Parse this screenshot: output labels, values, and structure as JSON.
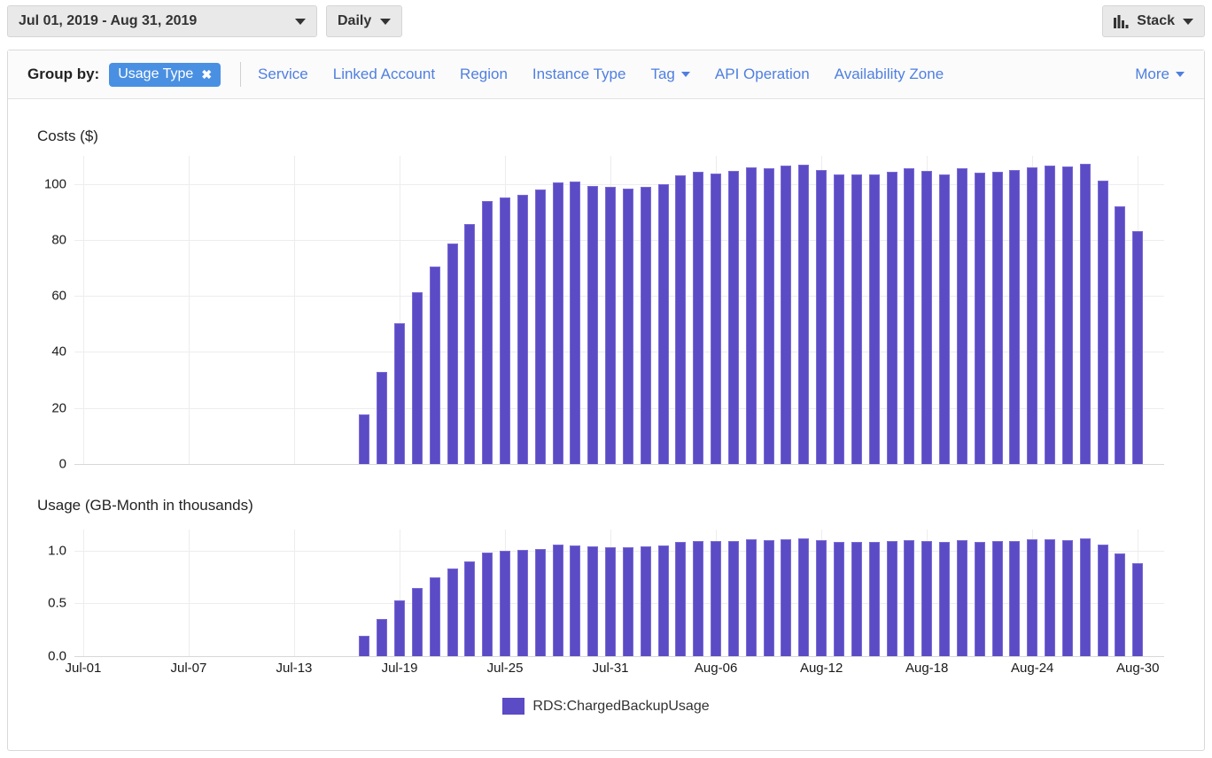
{
  "toolbar": {
    "date_range": "Jul 01, 2019 - Aug 31, 2019",
    "granularity": "Daily",
    "stack_label": "Stack",
    "stack_icon": "bar-chart-icon",
    "caret_icon": "chevron-down-icon"
  },
  "groupbar": {
    "label": "Group by:",
    "active_pill": "Usage Type",
    "pill_remove_icon": "close-icon",
    "options": [
      {
        "label": "Service",
        "has_caret": false
      },
      {
        "label": "Linked Account",
        "has_caret": false
      },
      {
        "label": "Region",
        "has_caret": false
      },
      {
        "label": "Instance Type",
        "has_caret": false
      },
      {
        "label": "Tag",
        "has_caret": true
      },
      {
        "label": "API Operation",
        "has_caret": false
      },
      {
        "label": "Availability Zone",
        "has_caret": false
      }
    ],
    "more": {
      "label": "More",
      "has_caret": true
    }
  },
  "legend": {
    "series_name": "RDS:ChargedBackupUsage",
    "color": "#5b4bc4"
  },
  "colors": {
    "bar": "#5b4bc4",
    "bar_edge": "#7a6bd6",
    "link": "#4f7fe0",
    "pill": "#4a90e2",
    "grid": "#ededed"
  },
  "chart_data": [
    {
      "type": "bar",
      "title": "Costs ($)",
      "ylabel": "Costs ($)",
      "xlabel": "",
      "ylim": [
        0,
        110
      ],
      "yticks": [
        0,
        20,
        40,
        60,
        80,
        100
      ],
      "ytick_labels": [
        "0",
        "20",
        "40",
        "60",
        "80",
        "100"
      ],
      "grid": true,
      "legend_position": "bottom",
      "x": [
        "Jul-01",
        "Jul-02",
        "Jul-03",
        "Jul-04",
        "Jul-05",
        "Jul-06",
        "Jul-07",
        "Jul-08",
        "Jul-09",
        "Jul-10",
        "Jul-11",
        "Jul-12",
        "Jul-13",
        "Jul-14",
        "Jul-15",
        "Jul-16",
        "Jul-17",
        "Jul-18",
        "Jul-19",
        "Jul-20",
        "Jul-21",
        "Jul-22",
        "Jul-23",
        "Jul-24",
        "Jul-25",
        "Jul-26",
        "Jul-27",
        "Jul-28",
        "Jul-29",
        "Jul-30",
        "Jul-31",
        "Aug-01",
        "Aug-02",
        "Aug-03",
        "Aug-04",
        "Aug-05",
        "Aug-06",
        "Aug-07",
        "Aug-08",
        "Aug-09",
        "Aug-10",
        "Aug-11",
        "Aug-12",
        "Aug-13",
        "Aug-14",
        "Aug-15",
        "Aug-16",
        "Aug-17",
        "Aug-18",
        "Aug-19",
        "Aug-20",
        "Aug-21",
        "Aug-22",
        "Aug-23",
        "Aug-24",
        "Aug-25",
        "Aug-26",
        "Aug-27",
        "Aug-28",
        "Aug-29",
        "Aug-30",
        "Aug-31"
      ],
      "xtick_labels": [
        "Jul-01",
        "Jul-07",
        "Jul-13",
        "Jul-19",
        "Jul-25",
        "Jul-31",
        "Aug-06",
        "Aug-12",
        "Aug-18",
        "Aug-24",
        "Aug-30"
      ],
      "xtick_indices": [
        0,
        6,
        12,
        18,
        24,
        30,
        36,
        42,
        48,
        54,
        60
      ],
      "series": [
        {
          "name": "RDS:ChargedBackupUsage",
          "color": "#5b4bc4",
          "values": [
            0,
            0,
            0,
            0,
            0,
            0,
            0,
            0,
            0,
            0,
            0,
            0,
            0,
            0,
            0,
            0,
            17.8,
            33.0,
            50.3,
            61.3,
            70.5,
            78.6,
            85.7,
            93.8,
            95.0,
            96.0,
            98.0,
            100.5,
            100.8,
            99.3,
            98.8,
            98.3,
            99.0,
            100.0,
            103.2,
            104.3,
            103.8,
            104.5,
            105.8,
            105.5,
            106.5,
            106.8,
            105.0,
            103.5,
            103.5,
            103.3,
            104.3,
            105.5,
            104.5,
            103.3,
            105.5,
            104.0,
            104.3,
            104.8,
            105.8,
            106.5,
            106.3,
            107.3,
            101.0,
            92.0,
            83.0,
            0
          ]
        }
      ]
    },
    {
      "type": "bar",
      "title": "Usage (GB-Month in thousands)",
      "ylabel": "Usage (GB-Month in thousands)",
      "xlabel": "",
      "ylim": [
        0,
        1.2
      ],
      "yticks": [
        0.0,
        0.5,
        1.0
      ],
      "ytick_labels": [
        "0.0",
        "0.5",
        "1.0"
      ],
      "grid": true,
      "legend_position": "bottom",
      "x": [
        "Jul-01",
        "Jul-02",
        "Jul-03",
        "Jul-04",
        "Jul-05",
        "Jul-06",
        "Jul-07",
        "Jul-08",
        "Jul-09",
        "Jul-10",
        "Jul-11",
        "Jul-12",
        "Jul-13",
        "Jul-14",
        "Jul-15",
        "Jul-16",
        "Jul-17",
        "Jul-18",
        "Jul-19",
        "Jul-20",
        "Jul-21",
        "Jul-22",
        "Jul-23",
        "Jul-24",
        "Jul-25",
        "Jul-26",
        "Jul-27",
        "Jul-28",
        "Jul-29",
        "Jul-30",
        "Jul-31",
        "Aug-01",
        "Aug-02",
        "Aug-03",
        "Aug-04",
        "Aug-05",
        "Aug-06",
        "Aug-07",
        "Aug-08",
        "Aug-09",
        "Aug-10",
        "Aug-11",
        "Aug-12",
        "Aug-13",
        "Aug-14",
        "Aug-15",
        "Aug-16",
        "Aug-17",
        "Aug-18",
        "Aug-19",
        "Aug-20",
        "Aug-21",
        "Aug-22",
        "Aug-23",
        "Aug-24",
        "Aug-25",
        "Aug-26",
        "Aug-27",
        "Aug-28",
        "Aug-29",
        "Aug-30",
        "Aug-31"
      ],
      "xtick_labels": [
        "Jul-01",
        "Jul-07",
        "Jul-13",
        "Jul-19",
        "Jul-25",
        "Jul-31",
        "Aug-06",
        "Aug-12",
        "Aug-18",
        "Aug-24",
        "Aug-30"
      ],
      "xtick_indices": [
        0,
        6,
        12,
        18,
        24,
        30,
        36,
        42,
        48,
        54,
        60
      ],
      "series": [
        {
          "name": "RDS:ChargedBackupUsage",
          "color": "#5b4bc4",
          "values": [
            0,
            0,
            0,
            0,
            0,
            0,
            0,
            0,
            0,
            0,
            0,
            0,
            0,
            0,
            0,
            0,
            0.19,
            0.35,
            0.53,
            0.65,
            0.745,
            0.83,
            0.9,
            0.985,
            1.0,
            1.005,
            1.015,
            1.055,
            1.05,
            1.04,
            1.035,
            1.03,
            1.04,
            1.05,
            1.085,
            1.095,
            1.09,
            1.095,
            1.105,
            1.1,
            1.11,
            1.115,
            1.1,
            1.085,
            1.085,
            1.08,
            1.09,
            1.1,
            1.095,
            1.085,
            1.1,
            1.085,
            1.09,
            1.095,
            1.105,
            1.11,
            1.1,
            1.115,
            1.06,
            0.975,
            0.885,
            0
          ]
        }
      ]
    }
  ]
}
